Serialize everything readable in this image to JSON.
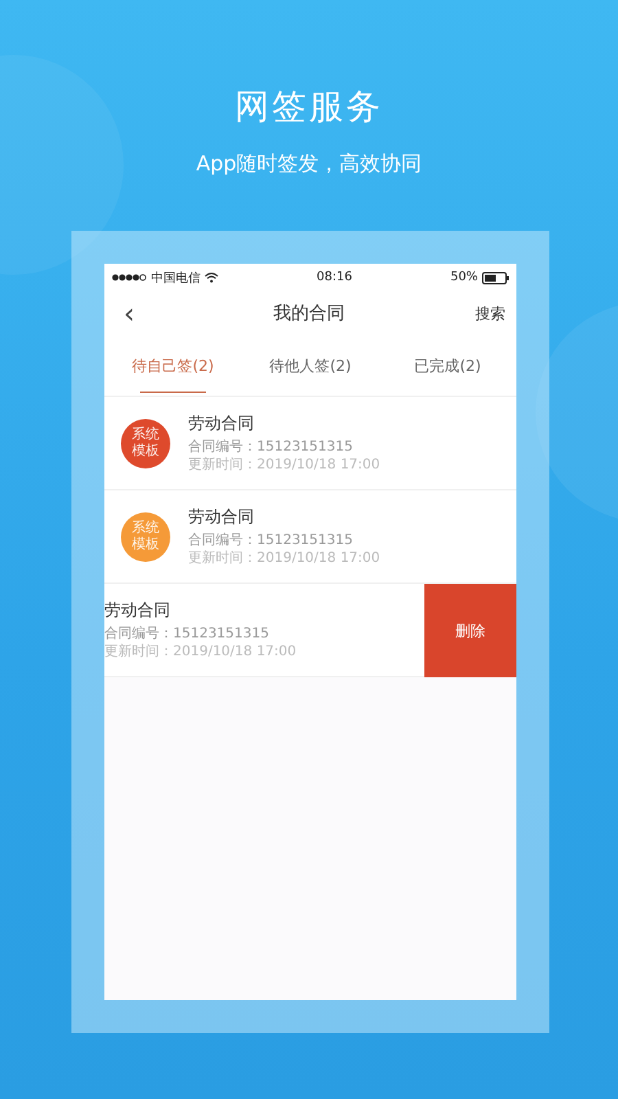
{
  "headline": {
    "title": "网签服务",
    "subtitle": "App随时签发，高效协同"
  },
  "status_bar": {
    "carrier": "中国电信",
    "time": "08:16",
    "battery": "50%"
  },
  "nav": {
    "back": "‹",
    "title": "我的合同",
    "action": "搜索"
  },
  "tabs": [
    {
      "label": "待自己签(2)",
      "selected": true
    },
    {
      "label": "待他人签(2)",
      "selected": false
    },
    {
      "label": "已完成(2)",
      "selected": false
    }
  ],
  "contracts": [
    {
      "kind": "badge",
      "badge": [
        "系统",
        "模板"
      ],
      "color": "#de4a2c",
      "title": "劳动合同",
      "number": "合同编号：15123151315",
      "updated": "更新时间：2019/10/18  17:00"
    },
    {
      "kind": "badge",
      "badge": [
        "系统",
        "模板"
      ],
      "color": "#f59a38",
      "title": "劳动合同",
      "number": "合同编号：15123151315",
      "updated": "更新时间：2019/10/18  17:00"
    },
    {
      "kind": "swiped",
      "delete": "删除",
      "title": "劳动合同",
      "number": "合同编号：15123151315",
      "updated": "更新时间：2019/10/18  17:00"
    }
  ]
}
